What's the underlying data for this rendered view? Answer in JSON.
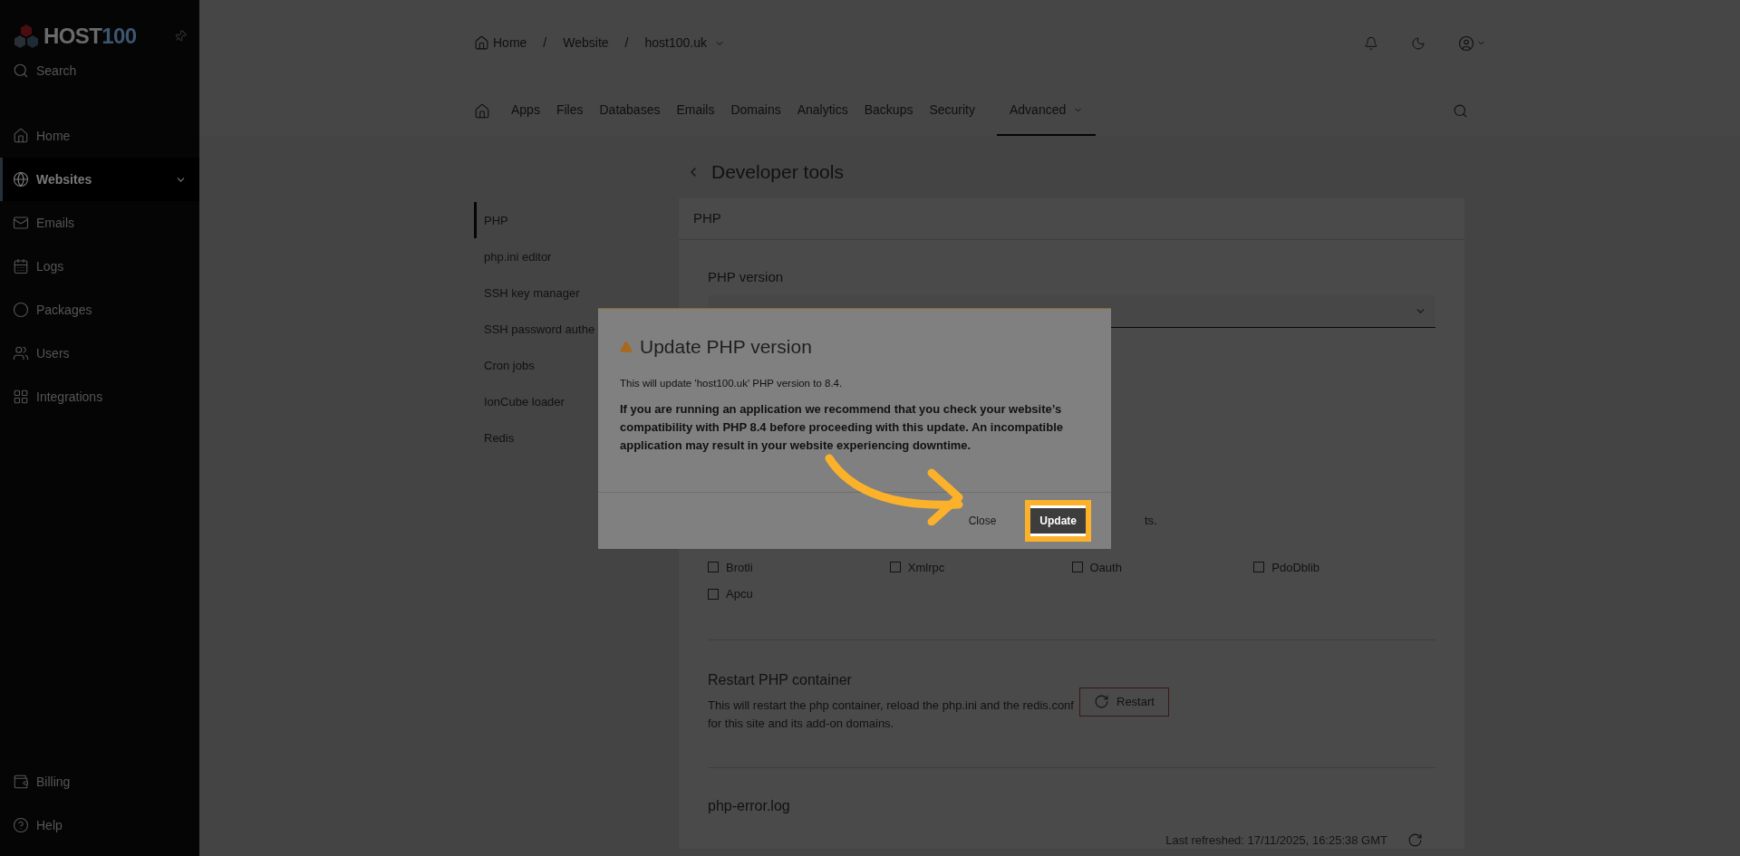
{
  "sidebar": {
    "logo_text": "HOST",
    "logo_number": "100",
    "search": "Search",
    "items": [
      {
        "label": "Home",
        "selected": false
      },
      {
        "label": "Websites",
        "selected": true
      },
      {
        "label": "Emails",
        "selected": false
      },
      {
        "label": "Logs",
        "selected": false
      },
      {
        "label": "Packages",
        "selected": false
      },
      {
        "label": "Users",
        "selected": false
      },
      {
        "label": "Integrations",
        "selected": false
      }
    ],
    "bottom_items": [
      {
        "label": "Billing"
      },
      {
        "label": "Help"
      }
    ]
  },
  "breadcrumb": [
    {
      "kind": "home",
      "label": "Home"
    },
    {
      "kind": "separator",
      "label": "/"
    },
    {
      "kind": "link",
      "label": "Website"
    },
    {
      "kind": "separator",
      "label": "/"
    },
    {
      "kind": "dropdown",
      "label": "host100.uk"
    }
  ],
  "nav": [
    {
      "label": "Apps",
      "selected": false
    },
    {
      "label": "Files",
      "selected": false
    },
    {
      "label": "Databases",
      "selected": false
    },
    {
      "label": "Emails",
      "selected": false
    },
    {
      "label": "Domains",
      "selected": false
    },
    {
      "label": "Analytics",
      "selected": false
    },
    {
      "label": "Backups",
      "selected": false
    },
    {
      "label": "Security",
      "selected": false
    },
    {
      "label": "Advanced",
      "selected": true
    }
  ],
  "page_title": "Developer tools",
  "submenu": [
    {
      "label": "PHP",
      "selected": true
    },
    {
      "label": "php.ini editor",
      "selected": false
    },
    {
      "label": "SSH key manager",
      "selected": false
    },
    {
      "label": "SSH password authe",
      "selected": false
    },
    {
      "label": "Cron jobs",
      "selected": false
    },
    {
      "label": "IonCube loader",
      "selected": false
    },
    {
      "label": "Redis",
      "selected": false
    }
  ],
  "card": {
    "title": "PHP",
    "php_version_label": "PHP version",
    "extensions_note": "ts.",
    "extensions": [
      {
        "label": "Brotli",
        "checked": false
      },
      {
        "label": "Xmlrpc",
        "checked": false
      },
      {
        "label": "Oauth",
        "checked": false
      },
      {
        "label": "PdoDblib",
        "checked": false
      },
      {
        "label": "Apcu",
        "checked": false
      }
    ],
    "restart": {
      "title": "Restart PHP container",
      "description": "This will restart the php container, reload the php.ini and the redis.conf for this site and its add-on domains.",
      "button": "Restart"
    },
    "log": {
      "title": "php-error.log",
      "last_refreshed": "Last refreshed: 17/11/2025, 16:25:38 GMT"
    }
  },
  "dialog": {
    "title": "Update PHP version",
    "message": "This will update 'host100.uk' PHP version to 8.4.",
    "warning": "If you are running an application we recommend that you check your website’s compatibility with PHP 8.4 before proceeding with this update. An incompatible application may result in your website experiencing downtime.",
    "buttons": [
      "Close",
      "Update"
    ]
  }
}
